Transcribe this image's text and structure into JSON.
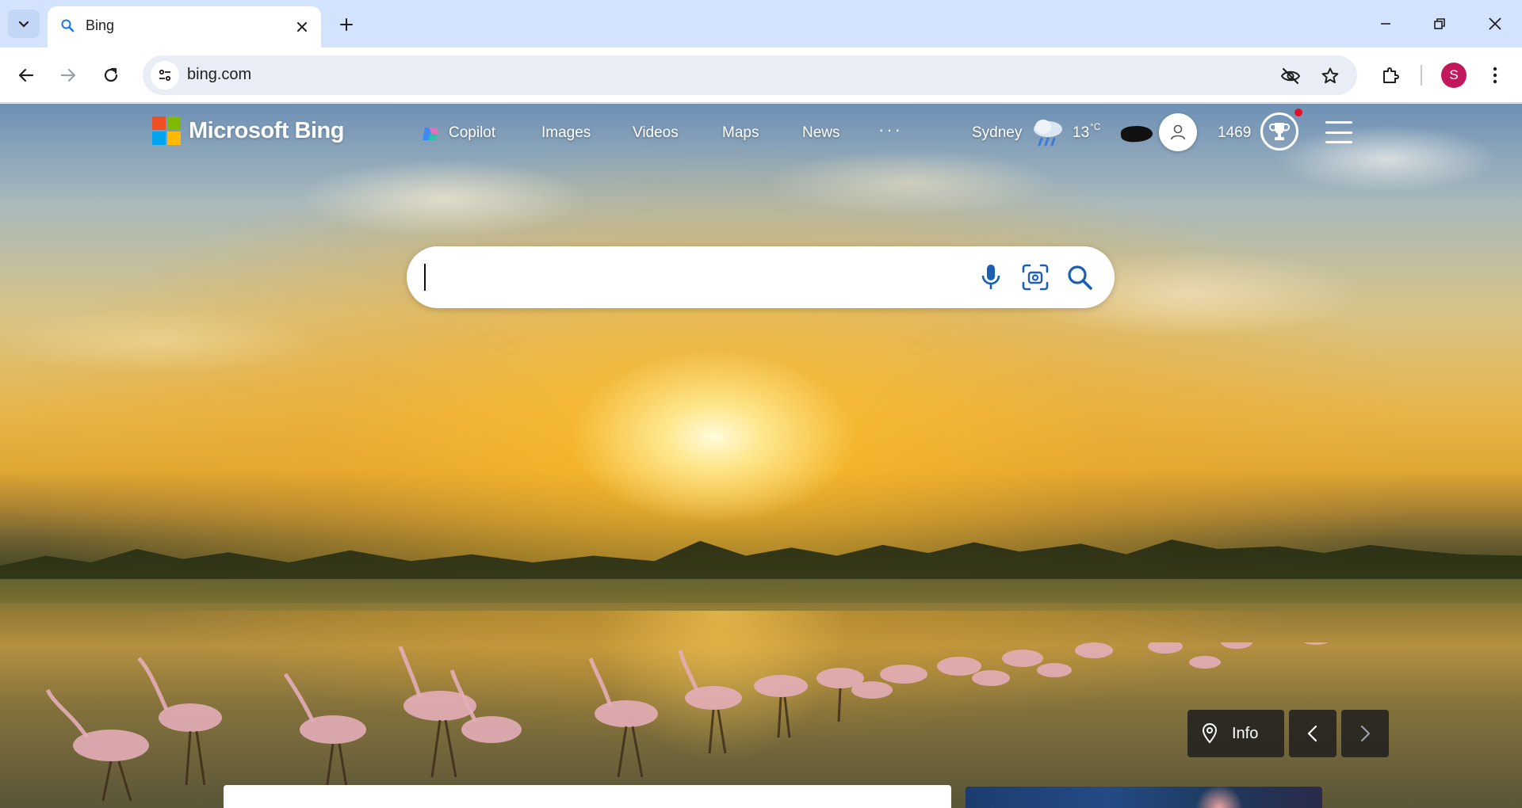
{
  "browser": {
    "tab": {
      "title": "Bing"
    },
    "url": "bing.com",
    "profile_initial": "S"
  },
  "bing": {
    "logo_text": "Microsoft Bing",
    "nav": [
      {
        "label": "Copilot",
        "icon": "copilot-icon"
      },
      {
        "label": "Images"
      },
      {
        "label": "Videos"
      },
      {
        "label": "Maps"
      },
      {
        "label": "News"
      }
    ],
    "more": "···",
    "location": "Sydney",
    "temperature": "13",
    "temperature_unit": "°C",
    "reward_points": "1469",
    "search": {
      "value": "",
      "placeholder": ""
    },
    "info_label": "Info"
  },
  "colors": {
    "ms_red": "#f25022",
    "ms_green": "#7fba00",
    "ms_blue": "#00a4ef",
    "ms_yellow": "#ffb900",
    "search_icon_blue": "#1a5fb4",
    "profile_bg": "#c2185b",
    "rewards_notification": "#e81123"
  }
}
